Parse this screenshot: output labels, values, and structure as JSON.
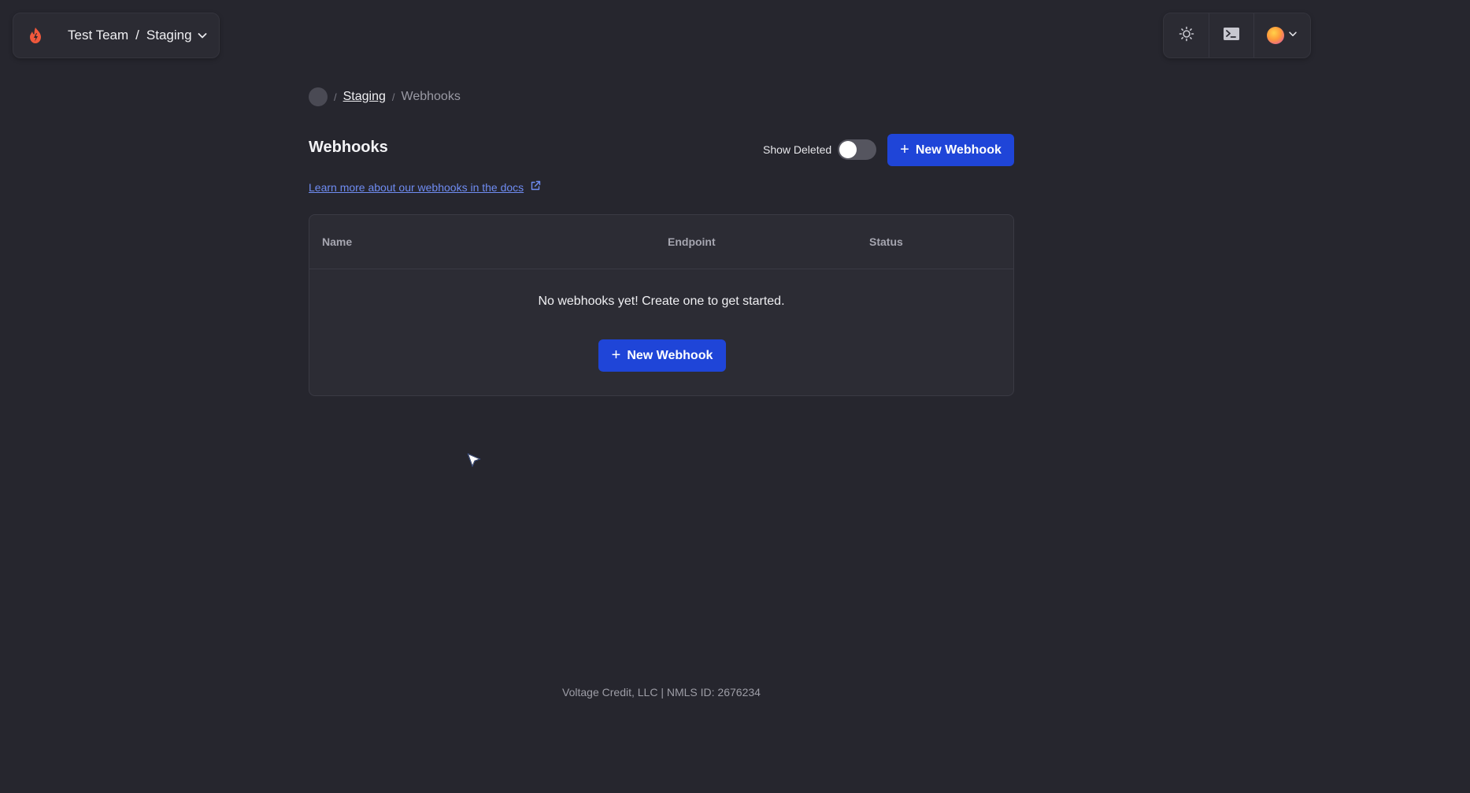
{
  "team_switcher": {
    "team": "Test Team",
    "separator": "/",
    "environment": "Staging"
  },
  "toolbar": {
    "theme_icon": "sun-icon",
    "console_icon": "terminal-icon",
    "user_icon": "avatar"
  },
  "breadcrumb": {
    "items": [
      {
        "label": "Staging"
      },
      {
        "label": "Webhooks"
      }
    ],
    "separator": "/"
  },
  "page": {
    "title": "Webhooks",
    "show_deleted_label": "Show Deleted",
    "show_deleted_value": false,
    "new_button_label": "New Webhook",
    "docs_link_label": "Learn more about our webhooks in the docs"
  },
  "table": {
    "columns": [
      "Name",
      "Endpoint",
      "Status"
    ],
    "rows": [],
    "empty_message": "No webhooks yet! Create one to get started.",
    "empty_button_label": "New Webhook"
  },
  "footer": {
    "text": "Voltage Credit, LLC | NMLS ID: 2676234"
  },
  "colors": {
    "background": "#26262e",
    "primary": "#1f45d8",
    "link": "#6f8cf2",
    "brand": "#f0583c"
  }
}
